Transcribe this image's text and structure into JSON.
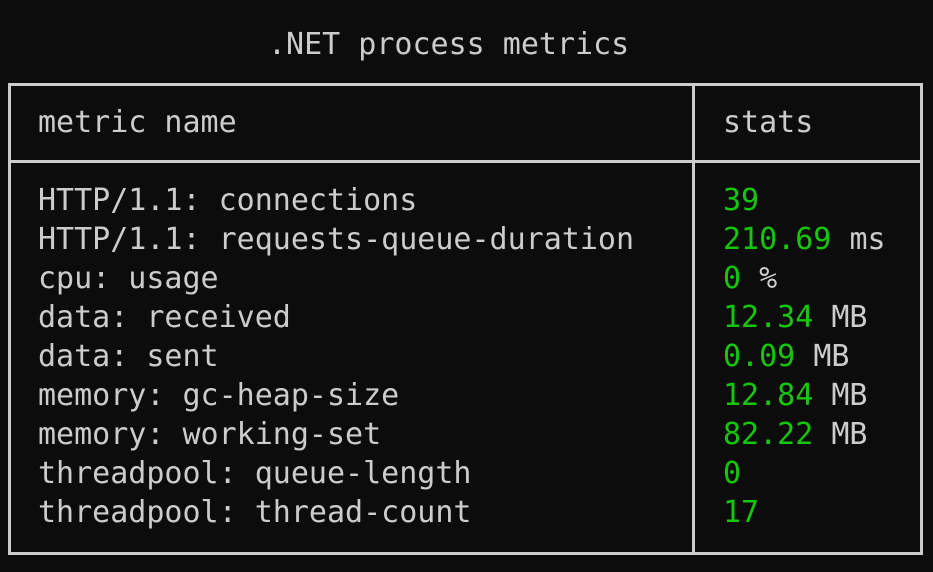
{
  "title": ".NET process metrics",
  "table": {
    "headers": {
      "name": "metric name",
      "stats": "stats"
    },
    "rows": [
      {
        "name": "HTTP/1.1: connections",
        "value": "39",
        "unit": ""
      },
      {
        "name": "HTTP/1.1: requests-queue-duration",
        "value": "210.69",
        "unit": "ms"
      },
      {
        "name": "cpu: usage",
        "value": "0",
        "unit": "%"
      },
      {
        "name": "data: received",
        "value": "12.34",
        "unit": "MB"
      },
      {
        "name": "data: sent",
        "value": "0.09",
        "unit": "MB"
      },
      {
        "name": "memory: gc-heap-size",
        "value": "12.84",
        "unit": "MB"
      },
      {
        "name": "memory: working-set",
        "value": "82.22",
        "unit": "MB"
      },
      {
        "name": "threadpool: queue-length",
        "value": "0",
        "unit": ""
      },
      {
        "name": "threadpool: thread-count",
        "value": "17",
        "unit": ""
      }
    ]
  },
  "colors": {
    "background": "#0c0c0c",
    "text": "#cccccc",
    "value": "#16c60c",
    "border": "#cccccc"
  }
}
